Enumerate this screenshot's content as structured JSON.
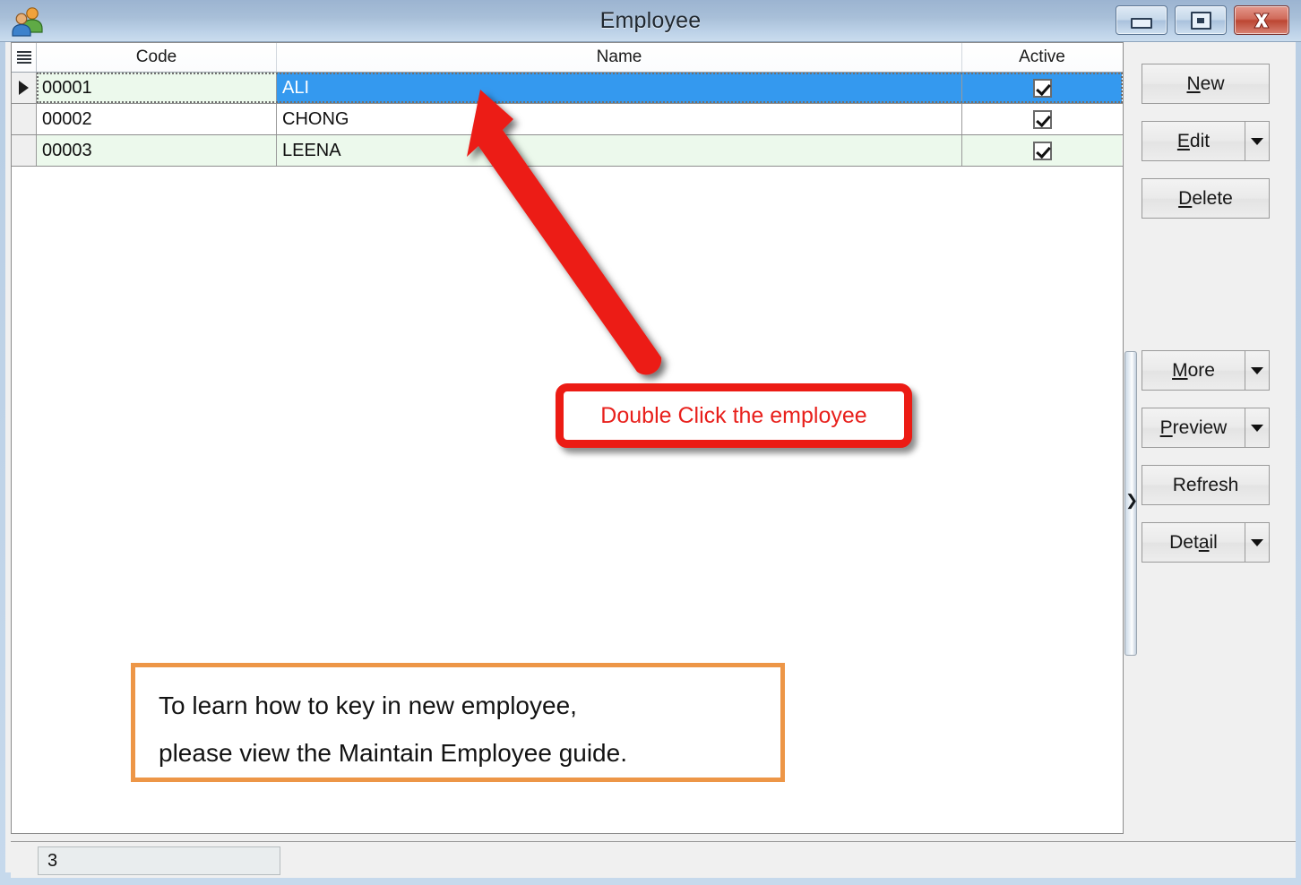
{
  "window": {
    "title": "Employee",
    "app_icon": "users-group-icon",
    "controls": {
      "minimize": "minimize-icon",
      "maximize": "restore-icon",
      "close": "close-icon"
    }
  },
  "grid": {
    "indicator_header_icon": "list-icon",
    "columns": [
      "Code",
      "Name",
      "Active"
    ],
    "rows": [
      {
        "code": "00001",
        "name": "ALI",
        "active": true,
        "selected": true,
        "current": true
      },
      {
        "code": "00002",
        "name": "CHONG",
        "active": true,
        "selected": false,
        "current": false
      },
      {
        "code": "00003",
        "name": "LEENA",
        "active": true,
        "selected": false,
        "current": false
      }
    ]
  },
  "splitter": {
    "chevron": "❯"
  },
  "buttons": [
    {
      "label_pre": "",
      "label_acc": "N",
      "label_post": "ew",
      "has_dropdown": false,
      "name": "new-button"
    },
    {
      "label_pre": "",
      "label_acc": "E",
      "label_post": "dit",
      "has_dropdown": true,
      "name": "edit-button"
    },
    {
      "label_pre": "",
      "label_acc": "D",
      "label_post": "elete",
      "has_dropdown": false,
      "name": "delete-button"
    },
    {
      "label_pre": "",
      "label_acc": "M",
      "label_post": "ore",
      "has_dropdown": true,
      "name": "more-button"
    },
    {
      "label_pre": "",
      "label_acc": "P",
      "label_post": "review",
      "has_dropdown": true,
      "name": "preview-button"
    },
    {
      "label_pre": "Refresh",
      "label_acc": "",
      "label_post": "",
      "has_dropdown": false,
      "name": "refresh-button"
    },
    {
      "label_pre": "Det",
      "label_acc": "a",
      "label_post": "il",
      "has_dropdown": true,
      "name": "detail-button"
    }
  ],
  "statusbar": {
    "record_count": "3"
  },
  "annotations": {
    "red_callout": "Double Click the employee",
    "orange_callout_line1": "To learn how to key in new employee,",
    "orange_callout_line2": "please view the Maintain Employee guide.",
    "arrow": "red-arrow-icon"
  },
  "colors": {
    "selection_blue": "#3499ef",
    "alt_row_green": "#ecf9ec",
    "annotation_red": "#ec1b14",
    "annotation_orange": "#ed9647",
    "titlebar_blue": "#a8bfd8"
  }
}
